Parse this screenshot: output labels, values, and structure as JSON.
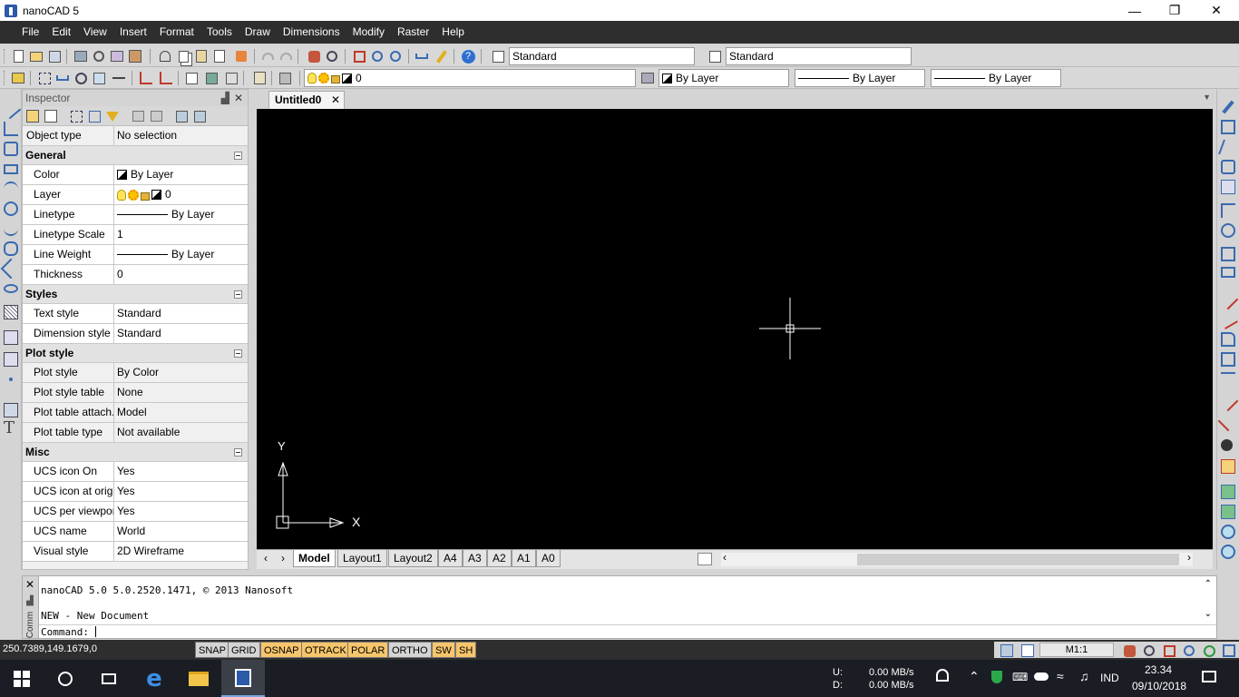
{
  "window": {
    "title": "nanoCAD 5"
  },
  "menu": [
    "File",
    "Edit",
    "View",
    "Insert",
    "Format",
    "Tools",
    "Draw",
    "Dimensions",
    "Modify",
    "Raster",
    "Help"
  ],
  "toolbar": {
    "text_style": "Standard",
    "dim_style": "Standard",
    "layer": "0",
    "color": "By Layer",
    "linetype": "By Layer",
    "lineweight": "By Layer"
  },
  "inspector": {
    "title": "Inspector",
    "object_type": {
      "name": "Object type",
      "value": "No selection"
    },
    "groups": [
      {
        "name": "General",
        "rows": [
          {
            "name": "Color",
            "value": "By Layer"
          },
          {
            "name": "Layer",
            "value": "0"
          },
          {
            "name": "Linetype",
            "value": "By Layer"
          },
          {
            "name": "Linetype Scale",
            "value": "1"
          },
          {
            "name": "Line Weight",
            "value": "By Layer"
          },
          {
            "name": "Thickness",
            "value": "0"
          }
        ]
      },
      {
        "name": "Styles",
        "rows": [
          {
            "name": "Text style",
            "value": "Standard"
          },
          {
            "name": "Dimension style",
            "value": "Standard"
          }
        ]
      },
      {
        "name": "Plot style",
        "rows": [
          {
            "name": "Plot style",
            "value": "By Color"
          },
          {
            "name": "Plot style table",
            "value": "None"
          },
          {
            "name": "Plot table attach...",
            "value": "Model"
          },
          {
            "name": "Plot table type",
            "value": "Not available"
          }
        ]
      },
      {
        "name": "Misc",
        "rows": [
          {
            "name": "UCS icon On",
            "value": "Yes"
          },
          {
            "name": "UCS icon at origin",
            "value": "Yes"
          },
          {
            "name": "UCS per viewport",
            "value": "Yes"
          },
          {
            "name": "UCS name",
            "value": "World"
          },
          {
            "name": "Visual style",
            "value": "2D Wireframe"
          }
        ]
      }
    ]
  },
  "document": {
    "tab": "Untitled0"
  },
  "ucs": {
    "x": "X",
    "y": "Y"
  },
  "layout_tabs": [
    "Model",
    "Layout1",
    "Layout2",
    "A4",
    "A3",
    "A2",
    "A1",
    "A0"
  ],
  "command": {
    "side_label": "Comm",
    "history": [
      "nanoCAD 5.0 5.0.2520.1471, © 2013 Nanosoft",
      "",
      "NEW - New Document"
    ],
    "prompt": "Command:"
  },
  "status": {
    "coords": "250.7389,149.1679,0",
    "toggles": [
      {
        "label": "SNAP",
        "on": false
      },
      {
        "label": "GRID",
        "on": false
      },
      {
        "label": "OSNAP",
        "on": true
      },
      {
        "label": "OTRACK",
        "on": true
      },
      {
        "label": "POLAR",
        "on": true
      },
      {
        "label": "ORTHO",
        "on": false
      },
      {
        "label": "SW",
        "on": true
      },
      {
        "label": "SH",
        "on": true
      }
    ],
    "scale": "M1:1"
  },
  "taskbar": {
    "net_u_label": "U:",
    "net_d_label": "D:",
    "net_u": "0.00 MB/s",
    "net_d": "0.00 MB/s",
    "lang": "IND",
    "time": "23.34",
    "date": "09/10/2018"
  },
  "colors": {
    "canvas": "#000000",
    "menubar": "#2e2e2e",
    "toggle_on": "#f7c56b",
    "taskbar": "#1a1d23"
  }
}
